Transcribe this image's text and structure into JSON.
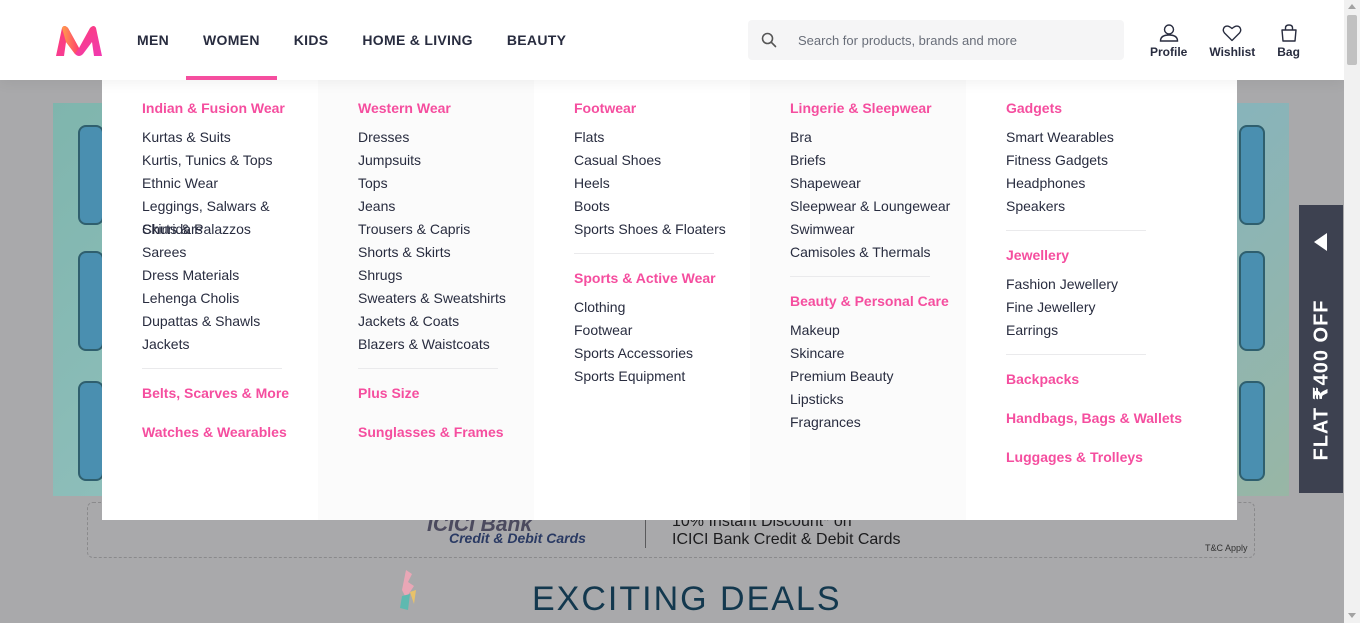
{
  "header": {
    "logo": "Myntra",
    "nav": [
      "MEN",
      "WOMEN",
      "KIDS",
      "HOME & LIVING",
      "BEAUTY"
    ],
    "active_nav": "WOMEN",
    "search_placeholder": "Search for products, brands and more",
    "actions": [
      {
        "label": "Profile",
        "icon": "profile-icon"
      },
      {
        "label": "Wishlist",
        "icon": "heart-icon"
      },
      {
        "label": "Bag",
        "icon": "bag-icon"
      }
    ]
  },
  "colors": {
    "accent": "#f54e9f",
    "text": "#282c3f"
  },
  "menu": {
    "col1": {
      "cat1": "Indian & Fusion Wear",
      "items1": [
        "Kurtas & Suits",
        "Kurtis, Tunics & Tops",
        "Ethnic Wear",
        "Leggings, Salwars & Churidars",
        "Skirts & Palazzos",
        "Sarees",
        "Dress Materials",
        "Lehenga Cholis",
        "Dupattas & Shawls",
        "Jackets"
      ],
      "cat2": "Belts, Scarves & More",
      "cat3": "Watches & Wearables"
    },
    "col2": {
      "cat1": "Western Wear",
      "items1": [
        "Dresses",
        "Jumpsuits",
        "Tops",
        "Jeans",
        "Trousers & Capris",
        "Shorts & Skirts",
        "Shrugs",
        "Sweaters & Sweatshirts",
        "Jackets & Coats",
        "Blazers & Waistcoats"
      ],
      "cat2": "Plus Size",
      "cat3": "Sunglasses & Frames"
    },
    "col3": {
      "cat1": "Footwear",
      "items1": [
        "Flats",
        "Casual Shoes",
        "Heels",
        "Boots",
        "Sports Shoes & Floaters"
      ],
      "cat2": "Sports & Active Wear",
      "items2": [
        "Clothing",
        "Footwear",
        "Sports Accessories",
        "Sports Equipment"
      ]
    },
    "col4": {
      "cat1": "Lingerie & Sleepwear",
      "items1": [
        "Bra",
        "Briefs",
        "Shapewear",
        "Sleepwear & Loungewear",
        "Swimwear",
        "Camisoles & Thermals"
      ],
      "cat2": "Beauty & Personal Care",
      "items2": [
        "Makeup",
        "Skincare",
        "Premium Beauty",
        "Lipsticks",
        "Fragrances"
      ]
    },
    "col5": {
      "cat1": "Gadgets",
      "items1": [
        "Smart Wearables",
        "Fitness Gadgets",
        "Headphones",
        "Speakers"
      ],
      "cat2": "Jewellery",
      "items2": [
        "Fashion Jewellery",
        "Fine Jewellery",
        "Earrings"
      ],
      "cat3": "Backpacks",
      "cat4": "Handbags, Bags & Wallets",
      "cat5": "Luggages & Trolleys"
    }
  },
  "background": {
    "bank_logo": "ICICI Bank",
    "bank_sub": "Credit & Debit Cards",
    "offer_line1": "10% Instant Discount* on",
    "offer_line2": "ICICI Bank Credit & Debit Cards",
    "tc": "T&C Apply",
    "deals_title": "EXCITING DEALS",
    "side_offer": "FLAT ₹400 OFF"
  }
}
